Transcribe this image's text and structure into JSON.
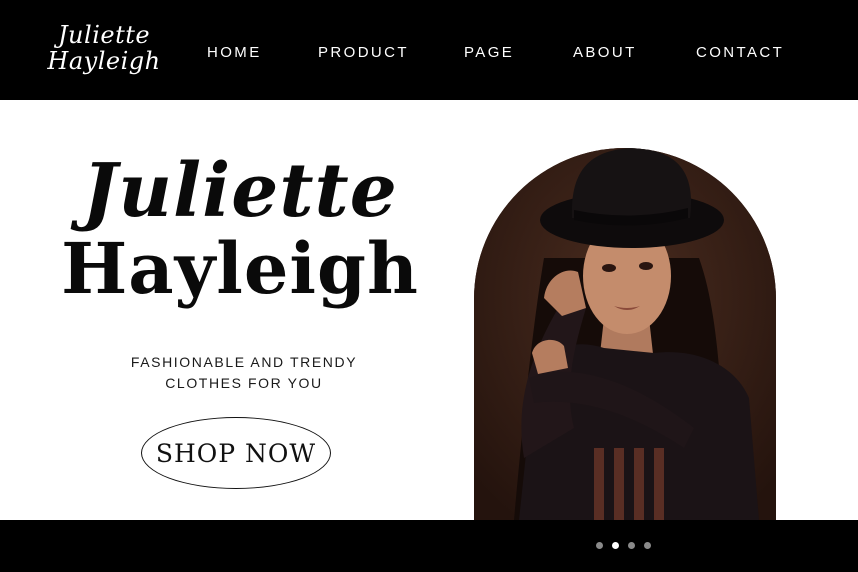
{
  "brand": {
    "logo_line1": "Juliette",
    "logo_line2": "Hayleigh"
  },
  "nav": {
    "items": [
      {
        "label": "HOME"
      },
      {
        "label": "PRODUCT"
      },
      {
        "label": "PAGE"
      },
      {
        "label": "ABOUT"
      },
      {
        "label": "CONTACT"
      }
    ]
  },
  "hero": {
    "title_line1": "Juliette",
    "title_line2": "Hayleigh",
    "tagline_line1": "FASHIONABLE AND TRENDY",
    "tagline_line2": "CLOTHES FOR YOU",
    "cta_label": "SHOP NOW"
  },
  "carousel": {
    "total": 4,
    "active": 2
  },
  "colors": {
    "bar": "#000000",
    "background": "#ffffff",
    "text": "#0a0a0a",
    "photo_backdrop": "#3a2218"
  }
}
